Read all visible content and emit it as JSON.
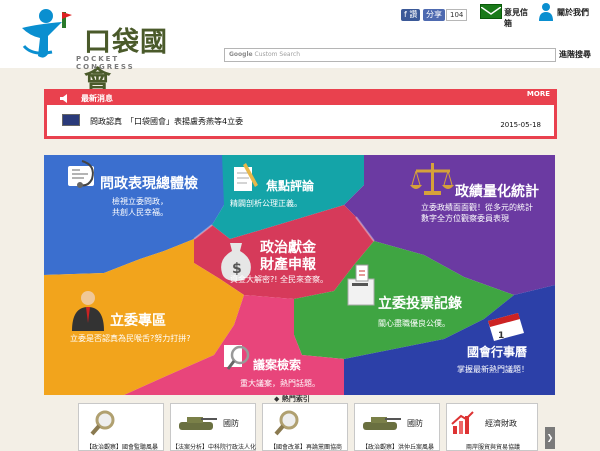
{
  "header": {
    "logo_title": "口袋國會",
    "logo_subtitle": "POCKET CONGRESS",
    "fb_label": "f 讚",
    "share_label": "分享",
    "share_count": "104",
    "mail_label": "意見信箱",
    "about_label": "關於我們",
    "search_brand": "Google",
    "search_placeholder": "Custom Search",
    "search_button": "進階搜尋"
  },
  "news": {
    "title": "最新消息",
    "more": "MORE",
    "text": "問政認真　「口袋國會」表揚盧秀燕等4立委",
    "date": "2015-05-18"
  },
  "sections": {
    "watch": {
      "title": "問政表現總體檢",
      "sub1": "檢視立委問政，",
      "sub2": "共創人民幸福。"
    },
    "focus": {
      "title": "焦點評論",
      "sub": "精闢剖析公理正義。"
    },
    "stats": {
      "title": "政績量化統計",
      "sub1": "立委政績面面觀！從多元的統計",
      "sub2": "數字全方位觀察委員表現"
    },
    "money": {
      "title1": "政治獻金",
      "title2": "財產申報",
      "sub": "資金大解密?! 全民來查察。"
    },
    "vote": {
      "title": "立委投票記錄",
      "sub": "關心盡職優良公僕。"
    },
    "zone": {
      "title": "立委專區",
      "sub": "立委是否認真為民喉舌?努力打拼?"
    },
    "calendar": {
      "title": "國會行事曆",
      "sub": "掌握最新熱門議題！"
    },
    "bills": {
      "title": "議案檢索",
      "sub": "重大議案，熱門話題。"
    }
  },
  "hot": {
    "title": "熱門索引",
    "cards": [
      {
        "tag": "",
        "label": "【政治觀察】國會監聽風暴"
      },
      {
        "tag": "國防",
        "label": "【法案分析】中科院行政法人化"
      },
      {
        "tag": "",
        "label": "【國會改革】再論黨團協商"
      },
      {
        "tag": "國防",
        "label": "【政治觀察】洪仲丘案風暴"
      },
      {
        "tag": "經濟財政",
        "label": "兩岸服貿與貿易協議"
      }
    ]
  },
  "colors": {
    "blue": "#3b6fcf",
    "purple": "#6b3aa2",
    "red": "#d63a5a",
    "orange": "#f2a41c",
    "green": "#3fa542",
    "darkblue": "#2c40a8",
    "pink": "#e8457b",
    "teal": "#14a4a8",
    "brand_green": "#4a5a2a",
    "news_red": "#e9414e"
  }
}
